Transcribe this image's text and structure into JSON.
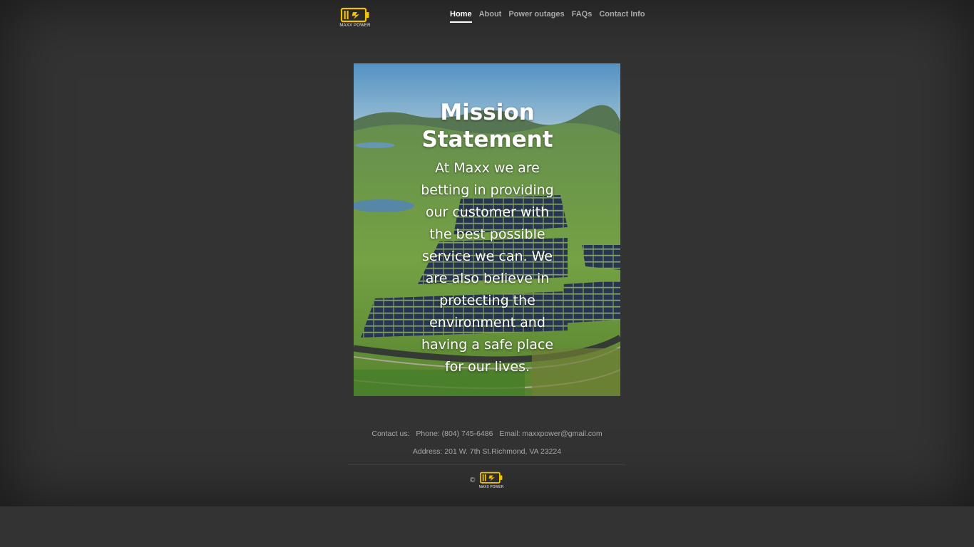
{
  "header": {
    "logo_text": "MAXX POWER",
    "nav": [
      {
        "label": "Home",
        "active": true
      },
      {
        "label": "About"
      },
      {
        "label": "Power outages"
      },
      {
        "label": "FAQs"
      },
      {
        "label": "Contact Info"
      }
    ]
  },
  "hero": {
    "title": "Mission Statement",
    "body": "At Maxx we are betting in providing our customer with the best possible service we can. We are also believe in protecting the environment and having a safe place for our lives."
  },
  "footer": {
    "contact_label": "Contact us:",
    "phone": "Phone: (804) 745-6486",
    "email": "Email: maxxpower@gmail.com",
    "address": "Address: 201 W. 7th St.Richmond, VA 23224",
    "copyright_symbol": "©",
    "logo_text": "MAXX POWER"
  },
  "colors": {
    "background": "#333333",
    "accent": "#f2c200",
    "nav_text": "#a8a8a8",
    "nav_active": "#ffffff"
  }
}
